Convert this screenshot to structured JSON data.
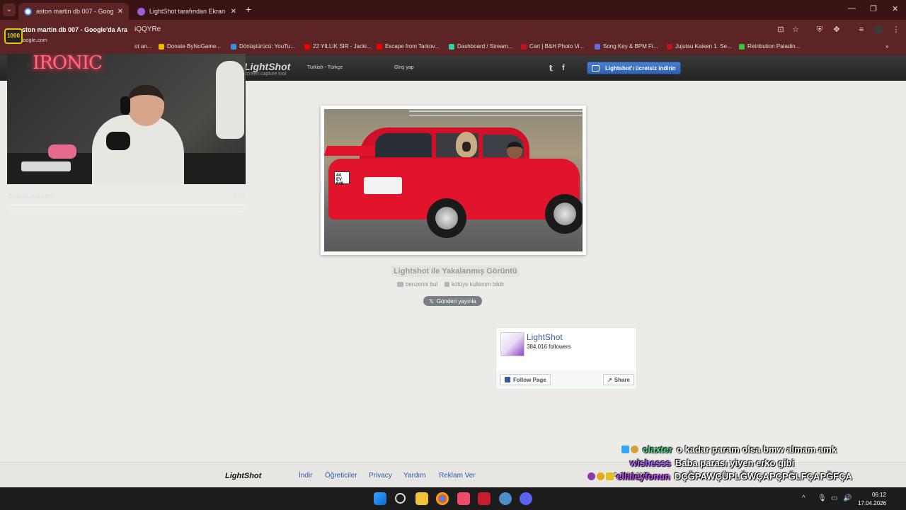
{
  "browser": {
    "tabs": [
      {
        "title": "aston martin db 007 - Google'da Ara",
        "active": true
      },
      {
        "title": "LightShot tarafından Ekran Görüntüsü",
        "active": false
      }
    ],
    "url": "iQQYRe",
    "tooltip": {
      "title": "aston martin db 007 - Google'da Ara",
      "domain": "google.com"
    },
    "bookmarks": [
      "ot an...",
      "Donate ByNoGame...",
      "Dönüştürücü: YouTu...",
      "22 YILLIK SIR - Jacki...",
      "Escape from Tarkov...",
      "Dashboard / Stream...",
      "Cart | B&H Photo Vi...",
      "Song Key & BPM Fi...",
      "Jujutsu Kaisen 1. Se...",
      "Retribution Paladin..."
    ],
    "more_bookmarks": "»"
  },
  "lightshot": {
    "logo": "LightShot",
    "tagline": "screen capture tool",
    "language": "Turkish - Türkçe",
    "login": "Giriş yap",
    "download_button": "Lightshot'ı ücretsiz indirin",
    "caption": "Lightshot ile Yakalanmış Görüntü",
    "find_similar": "benzerini bul",
    "report_abuse": "kötüye kullanım bildir",
    "tweet": "Gönderi yayınla"
  },
  "photo": {
    "plate_line1": "44 EV",
    "plate_line2": "949"
  },
  "facebook": {
    "name": "LightShot",
    "followers": "384,016 followers",
    "follow": "Follow Page",
    "share": "Share"
  },
  "footer": {
    "logo": "LightShot",
    "links": [
      "İndir",
      "Öğreticiler",
      "Privacy",
      "Yardım",
      "Reklam Ver"
    ],
    "copyright": "© 2009-2023"
  },
  "stream": {
    "neon_sign": "IRONIC",
    "badge": "1000",
    "subscribers_label": "SUBSCRIBERS",
    "subscribers_count": "0 / 4"
  },
  "chat": [
    {
      "user": "claxter",
      "message": "o kadar param olsa bmw almam amk",
      "color": "#4fe08c"
    },
    {
      "user": "wishesss",
      "message": "Baba parası yiyen erko gibi",
      "color": "#b266ff"
    },
    {
      "user": "ellaleyfonun",
      "message": "DÇĞPAWÇÜPLĞWÇAPÇPĞLFÇAPĞFÇA",
      "color": "#c44dff"
    }
  ],
  "taskbar": {
    "time": "06:12",
    "date": "17.04.2026"
  },
  "colors": {
    "titlebar": "#3a1414",
    "toolbar": "#5c2424",
    "download_btn": "#3a6fc2",
    "link": "#2a5db0"
  }
}
